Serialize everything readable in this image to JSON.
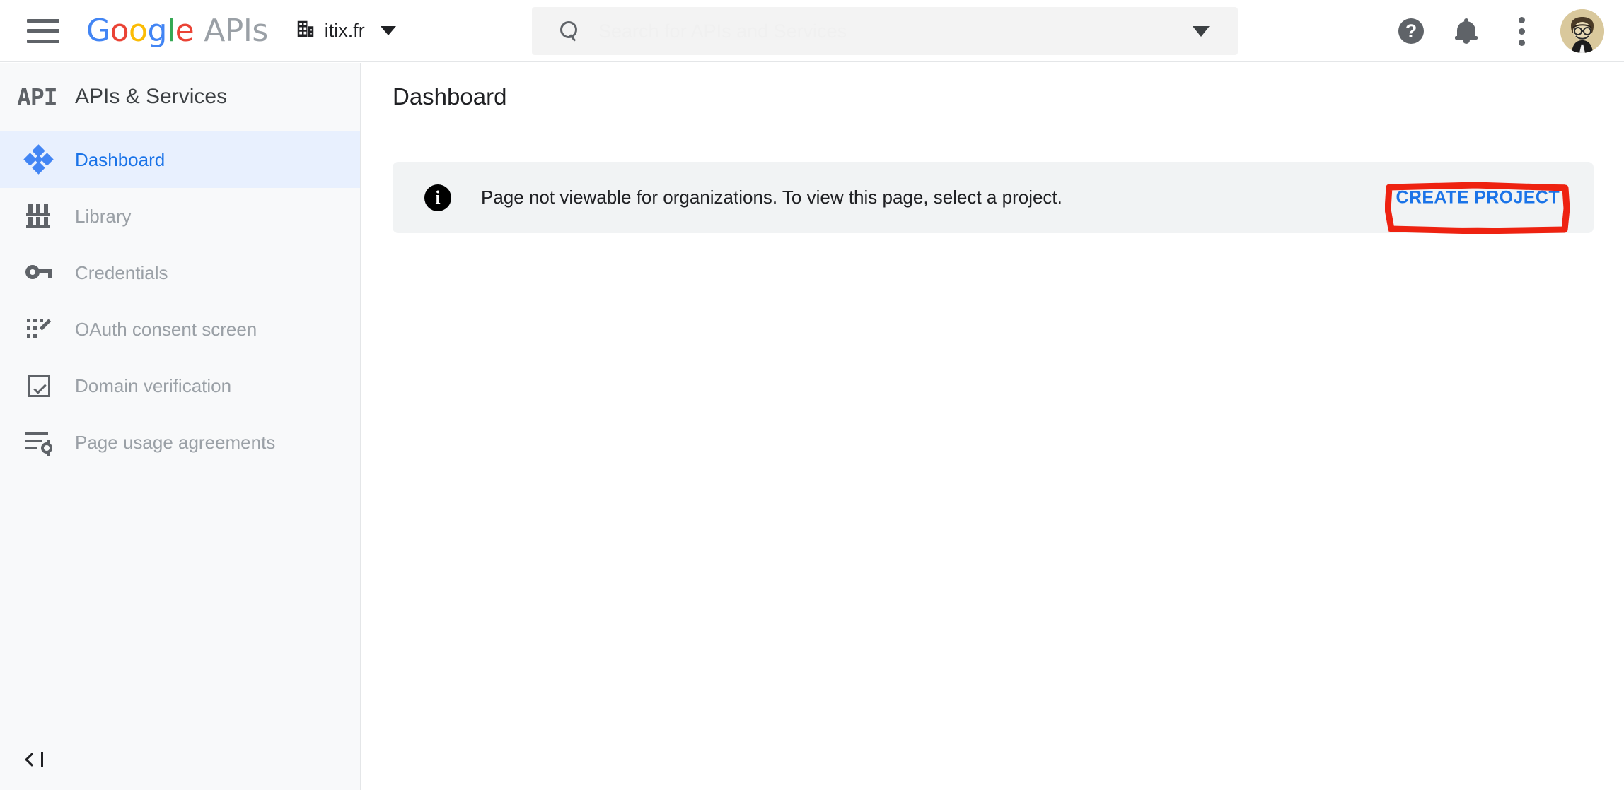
{
  "topbar": {
    "menu_icon": "hamburger-menu-icon",
    "logo": {
      "text": "Google",
      "letters": [
        "G",
        "o",
        "o",
        "g",
        "l",
        "e"
      ],
      "suffix": "APIs"
    },
    "org": {
      "icon": "building-icon",
      "name": "itix.fr",
      "caret": "chevron-down-icon"
    },
    "search": {
      "icon": "search-icon",
      "placeholder": "Search for APIs and Services",
      "value": "",
      "dropdown_icon": "chevron-down-icon"
    },
    "actions": [
      {
        "name": "help-icon",
        "glyph": "?"
      },
      {
        "name": "notifications-bell-icon",
        "glyph": "bell"
      },
      {
        "name": "more-options-icon",
        "glyph": "three-dots"
      },
      {
        "name": "avatar",
        "glyph": "user-avatar"
      }
    ]
  },
  "sidebar": {
    "badge": "API",
    "title": "APIs & Services",
    "items": [
      {
        "label": "Dashboard",
        "icon": "dashboard-diamond-icon",
        "active": true
      },
      {
        "label": "Library",
        "icon": "library-bookshelf-icon",
        "active": false
      },
      {
        "label": "Credentials",
        "icon": "key-icon",
        "active": false
      },
      {
        "label": "OAuth consent screen",
        "icon": "oauth-consent-icon",
        "active": false
      },
      {
        "label": "Domain verification",
        "icon": "checkbox-checked-icon",
        "active": false
      },
      {
        "label": "Page usage agreements",
        "icon": "list-settings-icon",
        "active": false
      }
    ],
    "collapse": {
      "label": "",
      "icon": "collapse-sidebar-icon"
    }
  },
  "main": {
    "page_title": "Dashboard",
    "banner": {
      "icon": "info-icon",
      "glyph": "i",
      "message": "Page not viewable for organizations. To view this page, select a project.",
      "action_label": "CREATE PROJECT"
    }
  },
  "annotation": {
    "target": "CREATE PROJECT",
    "shape": "red-hand-drawn-rectangle",
    "color": "#ee2211"
  },
  "colors": {
    "accent_blue": "#1a73e8",
    "sidebar_bg": "#f8f9fa",
    "active_item_bg": "#e8f0fe",
    "banner_bg": "#f1f3f4",
    "text_primary": "#202124",
    "text_muted": "#9aa0a6",
    "annotation_red": "#ee2211"
  }
}
